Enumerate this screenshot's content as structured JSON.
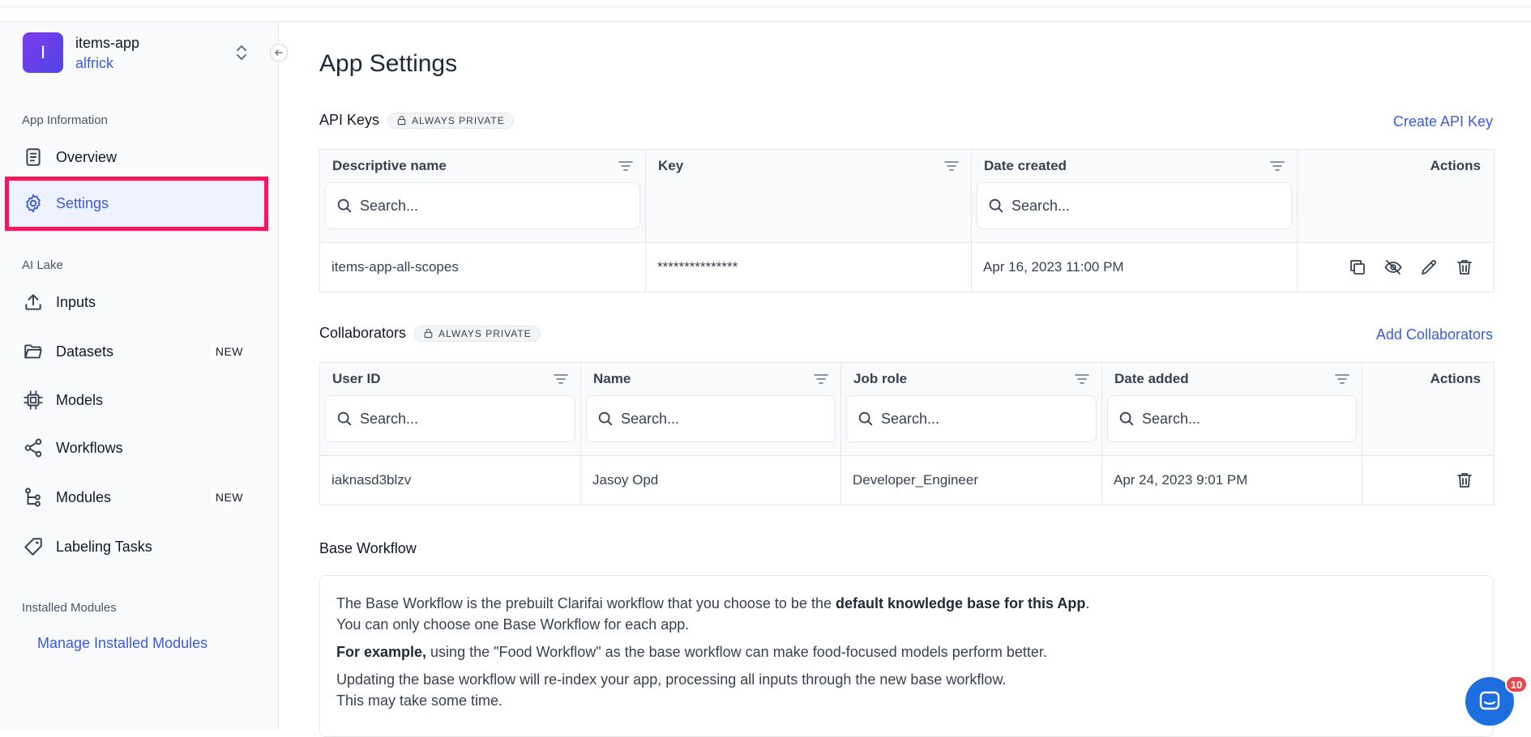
{
  "app": {
    "avatar_letter": "I",
    "name": "items-app",
    "owner": "alfrick"
  },
  "sidebar": {
    "section_app_info": "App Information",
    "overview": "Overview",
    "settings": "Settings",
    "section_ai_lake": "AI Lake",
    "inputs": "Inputs",
    "datasets": "Datasets",
    "datasets_badge": "NEW",
    "models": "Models",
    "workflows": "Workflows",
    "modules": "Modules",
    "modules_badge": "NEW",
    "labeling_tasks": "Labeling Tasks",
    "section_installed": "Installed Modules",
    "manage_installed": "Manage Installed Modules"
  },
  "page": {
    "title": "App Settings"
  },
  "api_keys": {
    "title": "API Keys",
    "privacy_badge": "ALWAYS PRIVATE",
    "create_link": "Create API Key",
    "columns": [
      "Descriptive name",
      "Key",
      "Date created",
      "Actions"
    ],
    "search_placeholder": "Search...",
    "rows": [
      {
        "name": "items-app-all-scopes",
        "key": "***************",
        "date": "Apr 16, 2023 11:00 PM"
      }
    ]
  },
  "collaborators": {
    "title": "Collaborators",
    "privacy_badge": "ALWAYS PRIVATE",
    "add_link": "Add Collaborators",
    "columns": [
      "User ID",
      "Name",
      "Job role",
      "Date added",
      "Actions"
    ],
    "search_placeholder": "Search...",
    "rows": [
      {
        "user_id": "iaknasd3blzv",
        "name": "Jasoy Opd",
        "job_role": "Developer_Engineer",
        "date": "Apr 24, 2023 9:01 PM"
      }
    ]
  },
  "base_workflow": {
    "title": "Base Workflow",
    "p1_a": "The Base Workflow is the prebuilt Clarifai workflow that you choose to be the ",
    "p1_b": "default knowledge base for this App",
    "p1_c": ".",
    "p1_d": "You can only choose one Base Workflow for each app.",
    "p2_a": "For example,",
    "p2_b": " using the \"Food Workflow\" as the base workflow can make food-focused models perform better.",
    "p3_a": "Updating the base workflow will re-index your app, processing all inputs through the new base workflow.",
    "p3_b": "This may take some time."
  },
  "chat": {
    "badge_count": "10"
  },
  "colors": {
    "accent": "#3b5bdb",
    "highlight_border": "#e81e5c",
    "chat_blue": "#1d6fe0",
    "badge_red": "#e5484d"
  }
}
